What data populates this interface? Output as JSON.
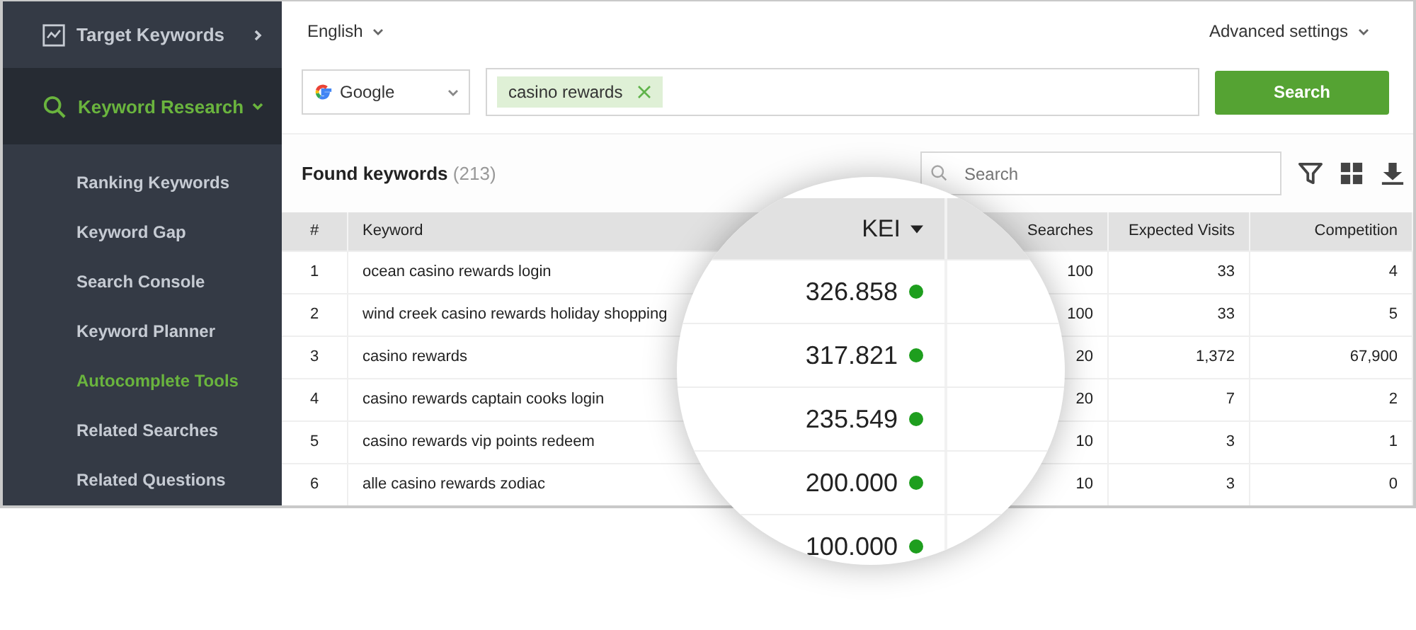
{
  "sidebar": {
    "items": [
      {
        "label": "Target Keywords",
        "selected": false,
        "expanded": false
      },
      {
        "label": "Keyword Research",
        "selected": true,
        "expanded": true,
        "children": [
          {
            "label": "Ranking Keywords",
            "selected": false
          },
          {
            "label": "Keyword Gap",
            "selected": false
          },
          {
            "label": "Search Console",
            "selected": false
          },
          {
            "label": "Keyword Planner",
            "selected": false
          },
          {
            "label": "Autocomplete Tools",
            "selected": true
          },
          {
            "label": "Related Searches",
            "selected": false
          },
          {
            "label": "Related Questions",
            "selected": false
          }
        ]
      }
    ]
  },
  "toolbar": {
    "language": "English",
    "advanced_settings": "Advanced settings"
  },
  "query": {
    "engine": "Google",
    "tags": [
      "casino rewards"
    ],
    "search_button": "Search"
  },
  "results": {
    "title": "Found keywords",
    "count": "(213)",
    "filter": {
      "placeholder": "Search"
    }
  },
  "table": {
    "columns": [
      "#",
      "Keyword",
      "Searches",
      "Expected Visits",
      "Competition"
    ],
    "rows": [
      {
        "index": "1",
        "keyword": "ocean casino rewards login",
        "searches": "100",
        "expected_visits": "33",
        "competition": "4"
      },
      {
        "index": "2",
        "keyword": "wind creek casino rewards holiday shopping",
        "searches": "100",
        "expected_visits": "33",
        "competition": "5"
      },
      {
        "index": "3",
        "keyword": "casino rewards",
        "searches": "20",
        "expected_visits": "1,372",
        "competition": "67,900"
      },
      {
        "index": "4",
        "keyword": "casino rewards captain cooks login",
        "searches": "20",
        "expected_visits": "7",
        "competition": "2"
      },
      {
        "index": "5",
        "keyword": "casino rewards vip points redeem",
        "searches": "10",
        "expected_visits": "3",
        "competition": "1"
      },
      {
        "index": "6",
        "keyword": "alle casino rewards zodiac",
        "searches": "10",
        "expected_visits": "3",
        "competition": "0"
      }
    ]
  },
  "magnifier": {
    "column": "KEI",
    "sort_descending": true,
    "values": [
      {
        "value": "326.858",
        "color": "#1e9e1e"
      },
      {
        "value": "317.821",
        "color": "#1e9e1e"
      },
      {
        "value": "235.549",
        "color": "#1e9e1e"
      },
      {
        "value": "200.000",
        "color": "#1e9e1e"
      },
      {
        "value": "100.000",
        "color": "#1e9e1e"
      }
    ]
  }
}
